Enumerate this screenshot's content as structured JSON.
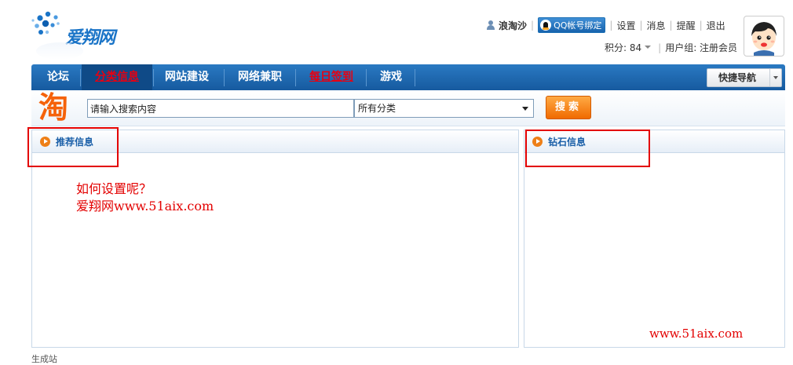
{
  "logo": {
    "text": "爱翔网"
  },
  "user": {
    "name": "浪淘沙",
    "qq_bind": "QQ帐号绑定",
    "links": [
      "设置",
      "消息",
      "提醒",
      "退出"
    ],
    "points_label": "积分: 84",
    "group_label": "用户组: 注册会员"
  },
  "nav": {
    "items": [
      {
        "label": "论坛"
      },
      {
        "label": "分类信息"
      },
      {
        "label": "网站建设"
      },
      {
        "label": "网络兼职"
      },
      {
        "label": "每日签到"
      },
      {
        "label": "游戏"
      }
    ],
    "quick_nav": "快捷导航"
  },
  "search": {
    "brand_char": "淘",
    "input_value": "请输入搜索内容",
    "category_selected": "所有分类",
    "button": "搜索"
  },
  "panels": {
    "left_title": "推荐信息",
    "right_title": "钻石信息"
  },
  "annotations": {
    "line1": "如何设置呢？",
    "line2": "爱翔网www.51aix.com",
    "watermark": "www.51aix.com"
  },
  "footer": {
    "text": "生成站"
  },
  "colors": {
    "nav_blue": "#1f6bb5",
    "accent_orange": "#f06a00",
    "annotation_red": "#e30000",
    "panel_title_blue": "#1a5fa8"
  }
}
